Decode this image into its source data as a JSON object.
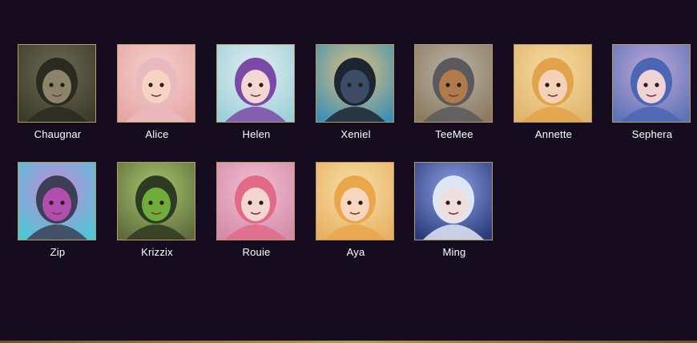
{
  "heroes": [
    {
      "name": "Chaugnar",
      "icon": "chaugnar-portrait",
      "bg": "#3a3b2a",
      "accent": "#6f6a52",
      "face": "#8b8468",
      "hair": "#2c2a20"
    },
    {
      "name": "Alice",
      "icon": "alice-portrait",
      "bg": "#e7a5a3",
      "accent": "#f3d1cf",
      "face": "#f6d3c3",
      "hair": "#e9b9c0"
    },
    {
      "name": "Helen",
      "icon": "helen-portrait",
      "bg": "#9bd0d8",
      "accent": "#e3eef1",
      "face": "#f3d7d3",
      "hair": "#7b4aa8"
    },
    {
      "name": "Xeniel",
      "icon": "xeniel-portrait",
      "bg": "#3d8fb6",
      "accent": "#e2c27a",
      "face": "#3b4d66",
      "hair": "#1d2533"
    },
    {
      "name": "TeeMee",
      "icon": "teemee-portrait",
      "bg": "#8b7a5f",
      "accent": "#b9b4a8",
      "face": "#b07a4a",
      "hair": "#5a5a5e"
    },
    {
      "name": "Annette",
      "icon": "annette-portrait",
      "bg": "#e0b46c",
      "accent": "#f6dca2",
      "face": "#f4d2b8",
      "hair": "#e3a34a"
    },
    {
      "name": "Sephera",
      "icon": "sephera-portrait",
      "bg": "#5b73b6",
      "accent": "#c2a8d9",
      "face": "#f0d3d6",
      "hair": "#4b66b3"
    },
    {
      "name": "Zip",
      "icon": "zip-portrait",
      "bg": "#4ec6d6",
      "accent": "#c38ad9",
      "face": "#b04fb0",
      "hair": "#3c3f55"
    },
    {
      "name": "Krizzix",
      "icon": "krizzix-portrait",
      "bg": "#5d6a3f",
      "accent": "#a7c86a",
      "face": "#6fae3a",
      "hair": "#2e3a22"
    },
    {
      "name": "Rouie",
      "icon": "rouie-portrait",
      "bg": "#d58aa7",
      "accent": "#f0c0d3",
      "face": "#f2d6cf",
      "hair": "#e06a88"
    },
    {
      "name": "Aya",
      "icon": "aya-portrait",
      "bg": "#e8b063",
      "accent": "#f6e0a8",
      "face": "#f6d6bd",
      "hair": "#eaa64b"
    },
    {
      "name": "Ming",
      "icon": "ming-portrait",
      "bg": "#2a3b7a",
      "accent": "#8fa0e8",
      "face": "#f1dede",
      "hair": "#dfe6f3"
    }
  ]
}
